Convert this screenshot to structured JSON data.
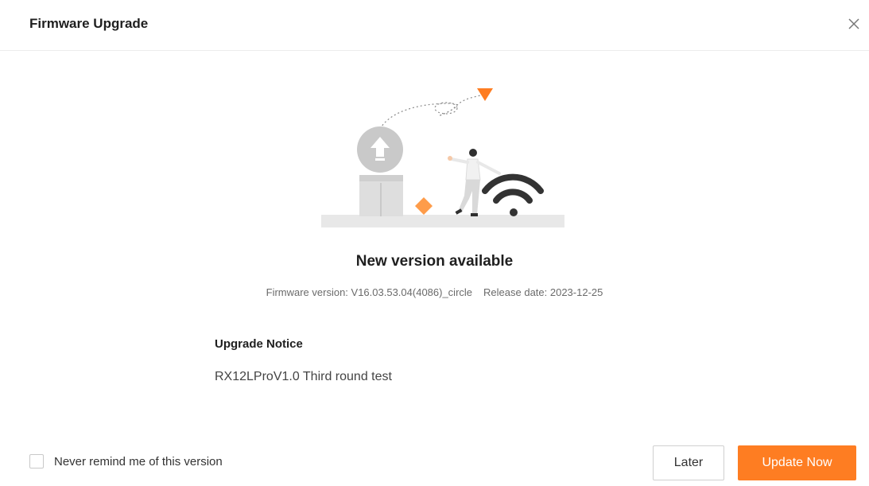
{
  "dialog": {
    "title": "Firmware Upgrade",
    "close_icon": "close-icon"
  },
  "content": {
    "headline": "New version available",
    "firmware_label": "Firmware version: V16.03.53.04(4086)_circle",
    "release_label": "Release date: 2023-12-25",
    "notice_title": "Upgrade Notice",
    "notice_body": "RX12LProV1.0 Third round test"
  },
  "footer": {
    "remind_label": "Never remind me of this version",
    "remind_checked": false,
    "later_label": "Later",
    "update_label": "Update Now"
  },
  "colors": {
    "accent": "#fe7d22",
    "illustration_gray": "#d6d6d6",
    "wifi_dark": "#333333"
  }
}
